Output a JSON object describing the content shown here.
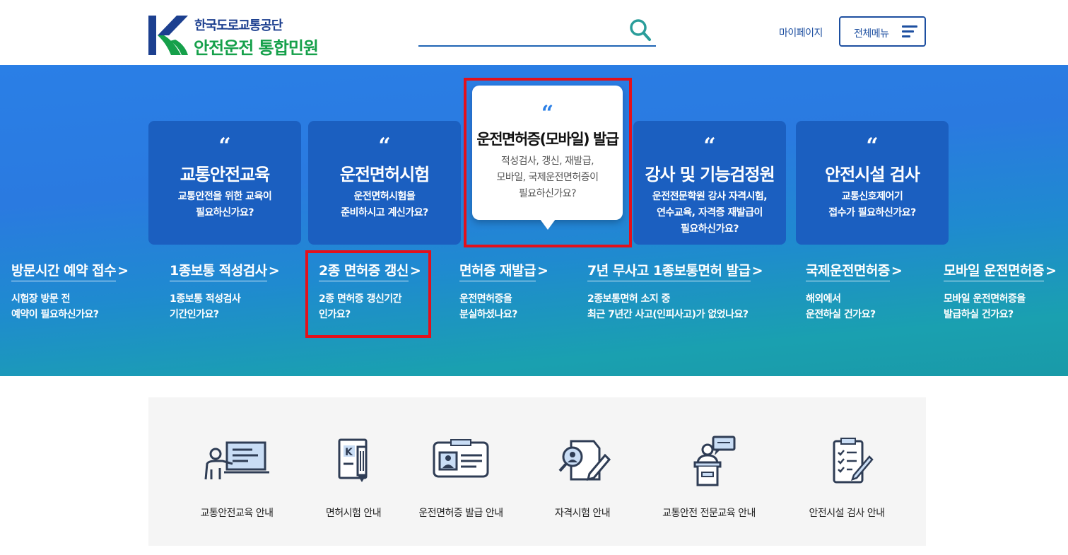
{
  "header": {
    "org_name": "한국도로교통공단",
    "site_title": "안전운전 통합민원",
    "search_placeholder": "",
    "mypage_label": "마이페이지",
    "allmenu_label": "전체메뉴"
  },
  "colors": {
    "brand_blue": "#1d4fa0",
    "brand_green": "#15a04a",
    "hero_top": "#2a7fe6",
    "hero_bottom": "#199aa8",
    "highlight_red": "#e3101b"
  },
  "cards": [
    {
      "quote": "“",
      "title": "교통안전교육",
      "desc": "교통안전을 위한 교육이\n필요하신가요?"
    },
    {
      "quote": "“",
      "title": "운전면허시험",
      "desc": "운전면허시험을\n준비하시고 계신가요?"
    },
    {
      "quote": "“",
      "title": "운전면허증(모바일) 발급",
      "desc": "적성검사, 갱신, 재발급,\n모바일, 국제운전면허증이\n필요하신가요?"
    },
    {
      "quote": "“",
      "title": "강사 및 기능검정원",
      "desc": "운전전문학원 강사 자격시험,\n연수교육, 자격증 재발급이\n필요하신가요?"
    },
    {
      "quote": "“",
      "title": "안전시설 검사",
      "desc": "교통신호제어기\n접수가 필요하신가요?"
    }
  ],
  "quick_links": [
    {
      "title": "방문시간 예약 접수",
      "arrow": ">",
      "desc": "시험장 방문 전\n예약이 필요하신가요?"
    },
    {
      "title": "1종보통 적성검사",
      "arrow": ">",
      "desc": "1종보통 적성검사\n기간인가요?"
    },
    {
      "title": "2종 면허증 갱신",
      "arrow": ">",
      "desc": "2종 면허증 갱신기간\n인가요?"
    },
    {
      "title": "면허증 재발급",
      "arrow": ">",
      "desc": "운전면허증을\n분실하셨나요?"
    },
    {
      "title": "7년 무사고 1종보통면허 발급",
      "arrow": ">",
      "desc": "2종보통면허 소지 중\n최근 7년간 사고(인피사고)가 없었나요?"
    },
    {
      "title": "국제운전면허증",
      "arrow": ">",
      "desc": "해외에서\n운전하실 건가요?"
    },
    {
      "title": "모바일 운전면허증",
      "arrow": ">",
      "desc": "모바일 운전면허증을\n발급하실 건가요?"
    }
  ],
  "services": [
    {
      "label": "교통안전교육 안내",
      "icon": "presentation-icon"
    },
    {
      "label": "면허시험 안내",
      "icon": "license-test-icon"
    },
    {
      "label": "운전면허증 발급 안내",
      "icon": "id-card-icon"
    },
    {
      "label": "자격시험 안내",
      "icon": "certificate-search-icon"
    },
    {
      "label": "교통안전 전문교육 안내",
      "icon": "lecturer-podium-icon"
    },
    {
      "label": "안전시설 검사 안내",
      "icon": "checklist-icon"
    }
  ]
}
